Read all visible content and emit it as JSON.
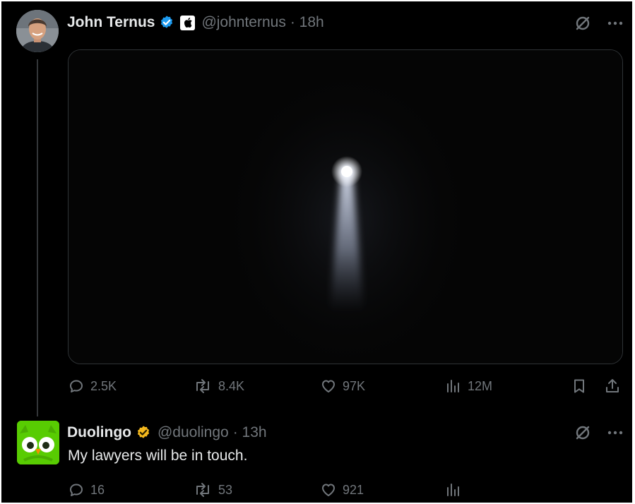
{
  "colors": {
    "background": "#000000",
    "primary_text": "#e7e9ea",
    "secondary_text": "#71767b",
    "verified_blue": "#1d9bf0",
    "verified_gold": "#f4b81d",
    "duolingo_green": "#58cc02"
  },
  "tweet": {
    "author": "John Ternus",
    "handle": "@johnternus",
    "time": "· 18h",
    "badge": "verified-blue-icon",
    "affiliation": "apple-logo-icon",
    "media": "spotlight-beam-image",
    "stats": {
      "replies": "2.5K",
      "reposts": "8.4K",
      "likes": "97K",
      "views": "12M"
    }
  },
  "reply": {
    "author": "Duolingo",
    "handle": "@duolingo",
    "time": "· 13h",
    "badge": "verified-gold-icon",
    "text": "My lawyers will be in touch.",
    "stats": {
      "replies": "16",
      "reposts": "53",
      "likes": "921"
    }
  }
}
